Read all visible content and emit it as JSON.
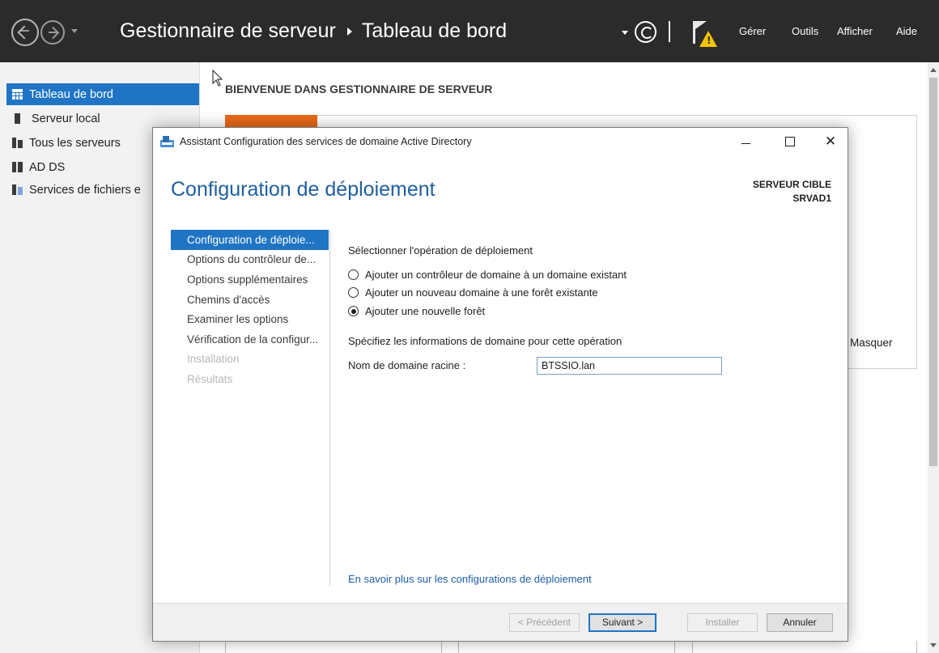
{
  "topbar": {
    "breadcrumb_app": "Gestionnaire de serveur",
    "breadcrumb_page": "Tableau de bord",
    "menu": [
      "Gérer",
      "Outils",
      "Afficher",
      "Aide"
    ]
  },
  "sidebar": {
    "items": [
      {
        "label": "Tableau de bord",
        "icon": "dashboard-icon",
        "active": true
      },
      {
        "label": "Serveur local",
        "icon": "server-icon"
      },
      {
        "label": "Tous les serveurs",
        "icon": "servers-icon"
      },
      {
        "label": "AD DS",
        "icon": "ad-ds-icon"
      },
      {
        "label": "Services de fichiers e",
        "icon": "file-services-icon"
      }
    ]
  },
  "main": {
    "welcome_title": "BIENVENUE DANS GESTIONNAIRE DE SERVEUR",
    "hide_label": "Masquer"
  },
  "dialog": {
    "title": "Assistant Configuration des services de domaine Active Directory",
    "heading": "Configuration de déploiement",
    "target_label": "SERVEUR CIBLE",
    "target_value": "SRVAD1",
    "steps": [
      {
        "label": "Configuration de déploie...",
        "state": "current"
      },
      {
        "label": "Options du contrôleur de...",
        "state": "normal"
      },
      {
        "label": "Options supplémentaires",
        "state": "normal"
      },
      {
        "label": "Chemins d'accès",
        "state": "normal"
      },
      {
        "label": "Examiner les options",
        "state": "normal"
      },
      {
        "label": "Vérification de la configur...",
        "state": "normal"
      },
      {
        "label": "Installation",
        "state": "disabled"
      },
      {
        "label": "Résultats",
        "state": "disabled"
      }
    ],
    "select_operation_label": "Sélectionner l'opération de déploiement",
    "options": [
      {
        "label": "Ajouter un contrôleur de domaine à un domaine existant",
        "checked": false
      },
      {
        "label": "Ajouter un nouveau domaine à une forêt existante",
        "checked": false
      },
      {
        "label": "Ajouter une nouvelle forêt",
        "checked": true
      }
    ],
    "domain_info_label": "Spécifiez les informations de domaine pour cette opération",
    "root_domain_label": "Nom de domaine racine :",
    "root_domain_value": "BTSSIO.lan",
    "learn_more_link": "En savoir plus sur les configurations de déploiement",
    "buttons": {
      "previous": "< Précédent",
      "next": "Suivant >",
      "install": "Installer",
      "cancel": "Annuler"
    }
  },
  "colors": {
    "accent": "#1f74c4",
    "titlebar": "#2b2b2b",
    "heading": "#1f5f9e",
    "warning": "#f5c400",
    "tile": "#e86a1a"
  }
}
